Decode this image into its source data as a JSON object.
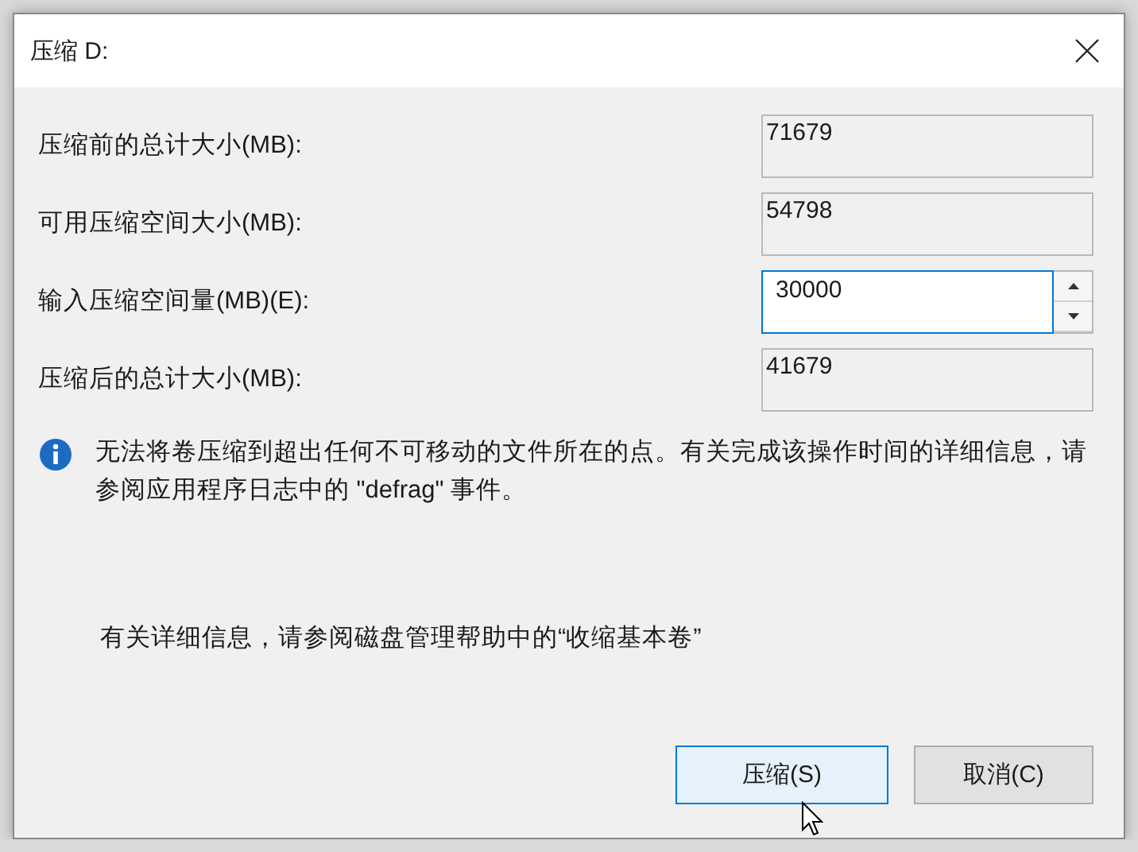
{
  "window": {
    "title": "压缩 D:"
  },
  "fields": [
    {
      "label": "压缩前的总计大小(MB):",
      "value": "71679",
      "kind": "readonly"
    },
    {
      "label": "可用压缩空间大小(MB):",
      "value": "54798",
      "kind": "readonly"
    },
    {
      "label": "输入压缩空间量(MB)(E):",
      "value": "30000",
      "kind": "spin"
    },
    {
      "label": "压缩后的总计大小(MB):",
      "value": "41679",
      "kind": "readonly"
    }
  ],
  "info": "无法将卷压缩到超出任何不可移动的文件所在的点。有关完成该操作时间的详细信息，请参阅应用程序日志中的 \"defrag\" 事件。",
  "help": "有关详细信息，请参阅磁盘管理帮助中的“收缩基本卷”",
  "buttons": [
    {
      "label": "压缩(S)",
      "default": true
    },
    {
      "label": "取消(C)",
      "default": false
    }
  ]
}
